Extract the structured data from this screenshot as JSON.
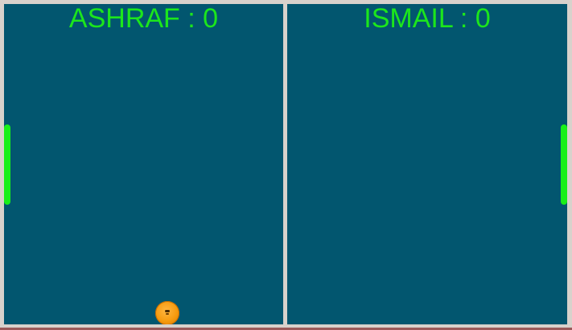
{
  "players": {
    "left": {
      "name": "ASHRAF",
      "score_label": "ASHRAF : 0",
      "score": 0
    },
    "right": {
      "name": "ISMAIL",
      "score_label": "ISMAIL : 0",
      "score": 0
    }
  },
  "colors": {
    "court": "#02566f",
    "border": "#d8d2cc",
    "score_text": "#1ce61c",
    "paddle": "#19f019",
    "ball": "#f59a0e"
  }
}
